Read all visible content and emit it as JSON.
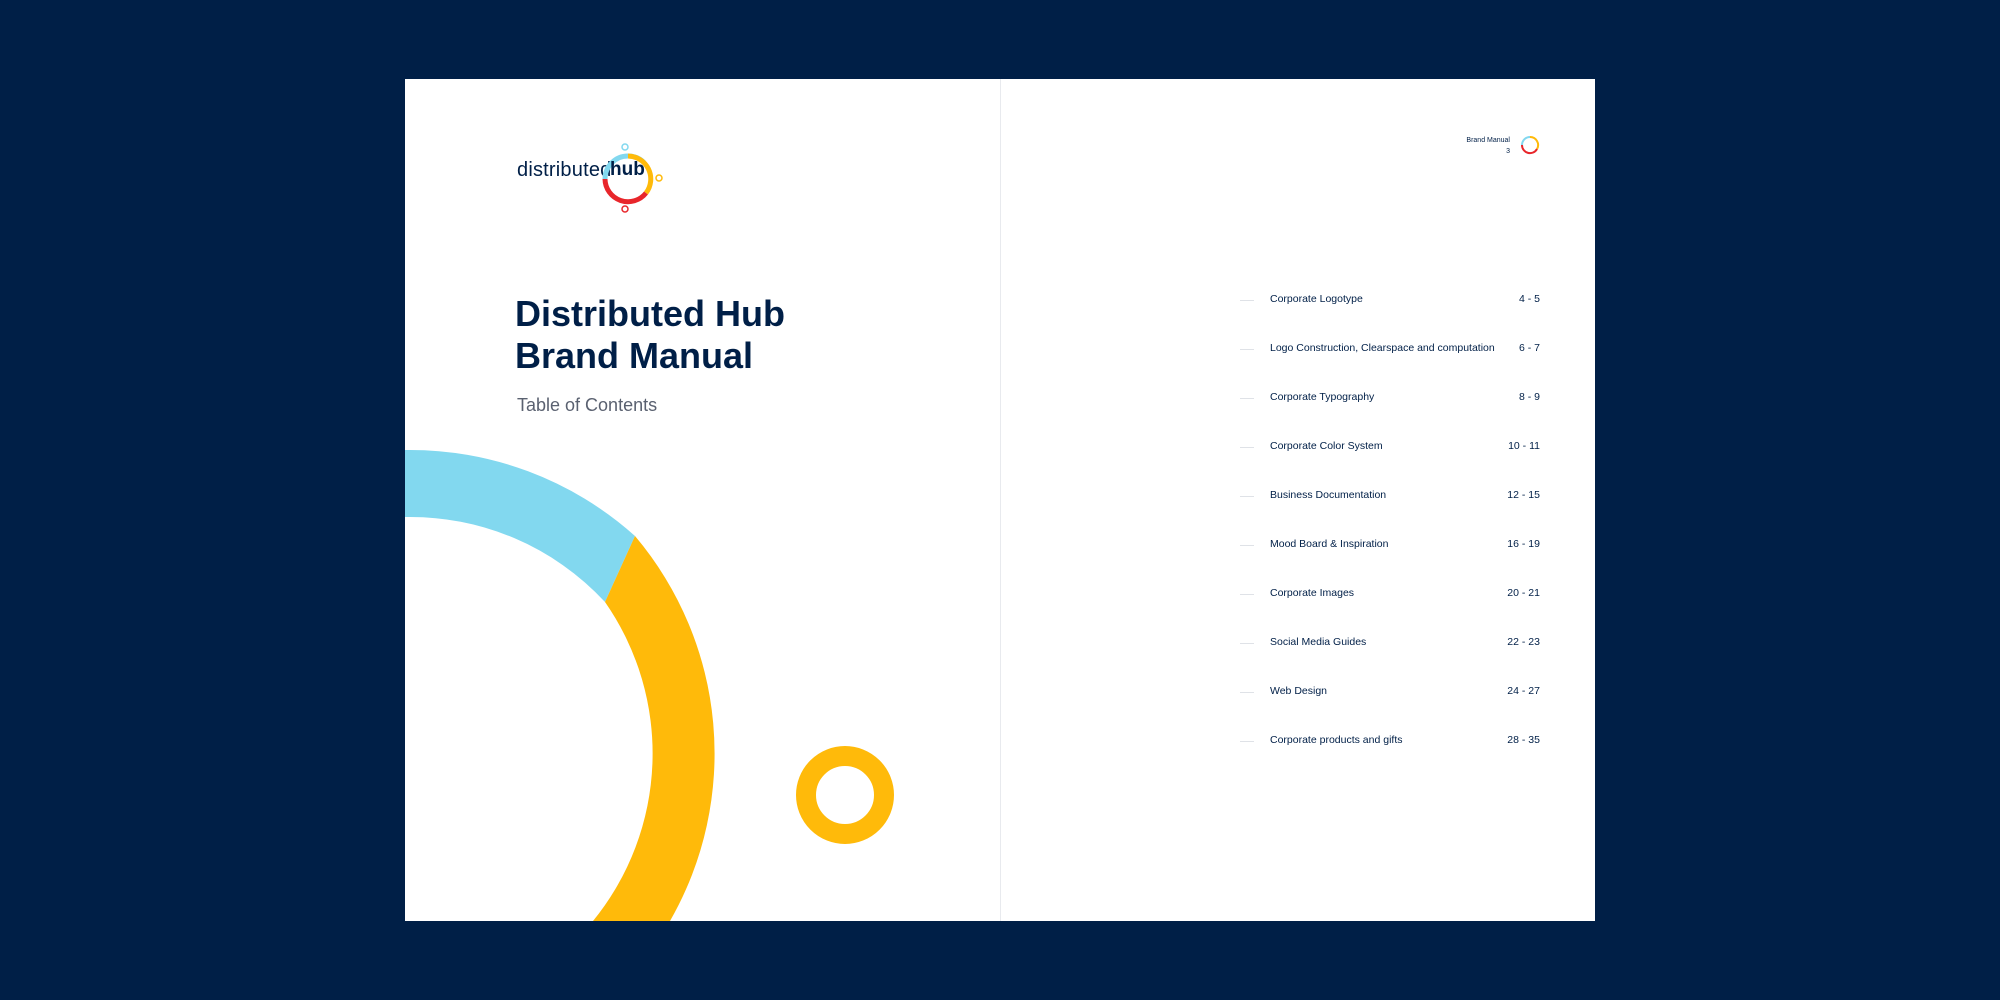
{
  "logo": {
    "word": "distributed",
    "hub": "hub"
  },
  "cover": {
    "title_line1": "Distributed Hub",
    "title_line2": "Brand Manual",
    "subtitle": "Table of Contents"
  },
  "running_head": {
    "label": "Brand Manual",
    "page_number": "3"
  },
  "colors": {
    "background": "#001f47",
    "navy": "#001f47",
    "light_blue": "#82d8ef",
    "yellow": "#ffba0a",
    "red": "#e8262b"
  },
  "toc": [
    {
      "label": "Corporate Logotype",
      "pages": "4 - 5"
    },
    {
      "label": "Logo Construction, Clearspace and computation",
      "pages": "6 - 7"
    },
    {
      "label": "Corporate Typography",
      "pages": "8 - 9"
    },
    {
      "label": "Corporate Color System",
      "pages": "10 - 11"
    },
    {
      "label": "Business Documentation",
      "pages": "12 - 15"
    },
    {
      "label": "Mood Board & Inspiration",
      "pages": "16 - 19"
    },
    {
      "label": "Corporate Images",
      "pages": "20 - 21"
    },
    {
      "label": "Social Media Guides",
      "pages": "22 - 23"
    },
    {
      "label": "Web Design",
      "pages": "24 - 27"
    },
    {
      "label": "Corporate products and gifts",
      "pages": "28 - 35"
    }
  ]
}
